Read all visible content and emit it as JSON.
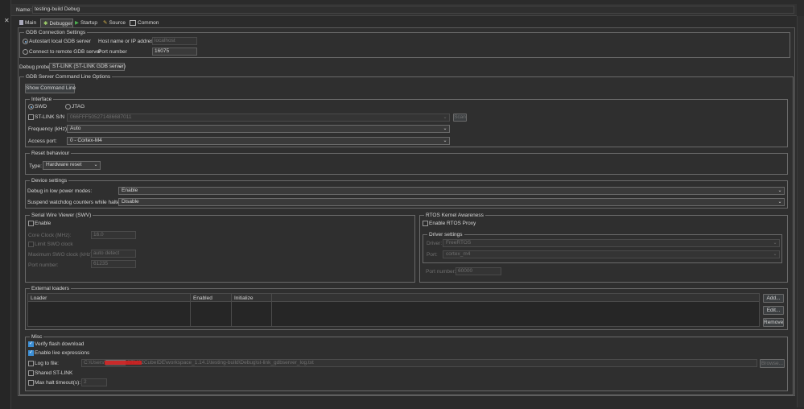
{
  "header": {
    "name_label": "Name:",
    "name_value": "testing-build Debug"
  },
  "tabs": [
    {
      "label": "Main"
    },
    {
      "label": "Debugger"
    },
    {
      "label": "Startup"
    },
    {
      "label": "Source"
    },
    {
      "label": "Common"
    }
  ],
  "gdb": {
    "title": "GDB Connection Settings",
    "autostart": "Autostart local GDB server",
    "remote": "Connect to remote GDB server",
    "host_label": "Host name or IP address",
    "host_value": "localhost",
    "port_label": "Port number",
    "port_value": "16075"
  },
  "probe": {
    "label": "Debug probe:",
    "value": "ST-LINK (ST-LINK GDB server)"
  },
  "server": {
    "title": "GDB Server Command Line Options",
    "show_cmd": "Show Command Line",
    "interface": {
      "title": "Interface",
      "swd": "SWD",
      "jtag": "JTAG",
      "stlink_sn": "ST-LINK S/N",
      "sn_value": "066FFF505271486687011",
      "scan": "Scan",
      "freq_label": "Frequency (kHz):",
      "freq_value": "Auto",
      "access_label": "Access port:",
      "access_value": "0 - Cortex-M4"
    },
    "reset": {
      "title": "Reset behaviour",
      "type_label": "Type:",
      "type_value": "Hardware reset"
    },
    "device": {
      "title": "Device settings",
      "lowpower_label": "Debug in low power modes:",
      "lowpower_value": "Enable",
      "watchdog_label": "Suspend watchdog counters while halted:",
      "watchdog_value": "Disable"
    },
    "swv": {
      "title": "Serial Wire Viewer (SWV)",
      "enable": "Enable",
      "core_clock_label": "Core Clock (MHz):",
      "core_clock_value": "16.0",
      "limit_swo": "Limit SWO clock",
      "max_swo_label": "Maximum SWO clock (kHz):",
      "max_swo_value": "auto detect",
      "port_label": "Port number:",
      "port_value": "61235"
    },
    "rtos": {
      "title": "RTOS Kernel Awareness",
      "enable": "Enable RTOS Proxy",
      "driver_settings": "Driver settings",
      "driver_label": "Driver:",
      "driver_value": "FreeRTOS",
      "port_label": "Port:",
      "port_value": "cortex_m4",
      "port_number_label": "Port number:",
      "port_number_value": "60000"
    },
    "loaders": {
      "title": "External loaders",
      "columns": [
        "Loader",
        "Enabled",
        "Initialize"
      ],
      "add": "Add...",
      "edit": "Edit...",
      "remove": "Remove"
    },
    "misc": {
      "title": "Misc",
      "verify": "Verify flash download",
      "live": "Enable live expressions",
      "log_label": "Log to file:",
      "log_value": "C:\\Users\\▇▇▇▇▇\\STM32CubeIDE\\workspace_1.14.1\\testing-build\\Debug\\st-link_gdbserver_log.txt",
      "browse": "Browse...",
      "shared": "Shared ST-LINK",
      "max_halt": "Max halt timeout(s):",
      "max_halt_value": "2"
    }
  },
  "colors": {
    "background": "#2b2b2b",
    "accent": "#3c8fd6",
    "redaction": "#d91f1f"
  }
}
